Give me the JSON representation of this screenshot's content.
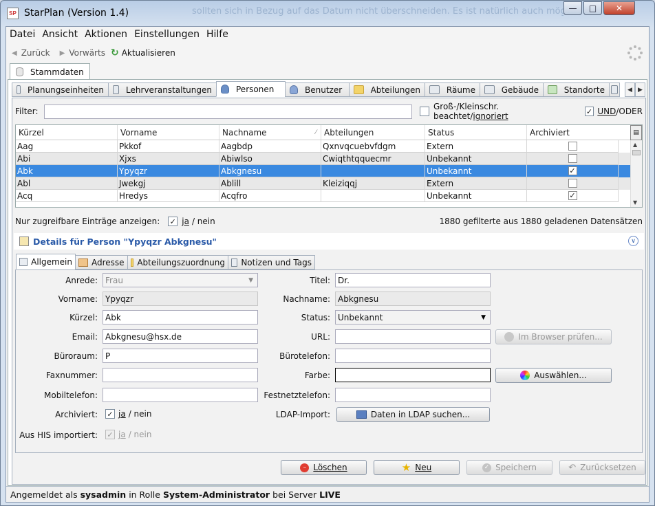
{
  "window": {
    "title": "StarPlan (Version 1.4)",
    "app_icon": "SP",
    "background_text": "sollten sich in Bezug auf das Datum nicht überschneiden. Es ist natürlich auch mög"
  },
  "menu": [
    {
      "label": "Datei"
    },
    {
      "label": "Ansicht"
    },
    {
      "label": "Aktionen"
    },
    {
      "label": "Einstellungen"
    },
    {
      "label": "Hilfe"
    }
  ],
  "nav": {
    "back": "Zurück",
    "forward": "Vorwärts",
    "refresh": "Aktualisieren"
  },
  "main_tab": "Stammdaten",
  "sub_tabs": [
    "Planungseinheiten",
    "Lehrveranstaltungen",
    "Personen",
    "Benutzer",
    "Abteilungen",
    "Räume",
    "Gebäude",
    "Standorte"
  ],
  "filter": {
    "label": "Filter:",
    "value": "",
    "case_label_pre": "Groß-/Kleinschr. beachtet/",
    "case_label_link": "ignoriert",
    "andor_label_link": "UND",
    "andor_label_post": "/ODER"
  },
  "table": {
    "columns": [
      "Kürzel",
      "Vorname",
      "Nachname",
      "Abteilungen",
      "Status",
      "Archiviert"
    ],
    "rows": [
      {
        "kuerzel": "Aag",
        "vorname": "Pkkof",
        "nachname": "Aagbdp",
        "abteilungen": "Qxnvqcuebvfdgm",
        "status": "Extern",
        "archiviert": false
      },
      {
        "kuerzel": "Abi",
        "vorname": "Xjxs",
        "nachname": "Abiwlso",
        "abteilungen": "Cwiqthtqquecmr",
        "status": "Unbekannt",
        "archiviert": false
      },
      {
        "kuerzel": "Abk",
        "vorname": "Ypyqzr",
        "nachname": "Abkgnesu",
        "abteilungen": "",
        "status": "Unbekannt",
        "archiviert": true
      },
      {
        "kuerzel": "Abl",
        "vorname": "Jwekgj",
        "nachname": "Ablill",
        "abteilungen": "Kleiziqqj",
        "status": "Extern",
        "archiviert": false
      },
      {
        "kuerzel": "Acq",
        "vorname": "Hredys",
        "nachname": "Acqfro",
        "abteilungen": "",
        "status": "Unbekannt",
        "archiviert": true
      }
    ]
  },
  "only_accessible": {
    "label": "Nur zugreifbare Einträge anzeigen:",
    "ja": "ja",
    "nein": "/ nein"
  },
  "count_text": "1880 gefilterte aus 1880 geladenen Datensätzen",
  "details_title": "Details für Person \"Ypyqzr Abkgnesu\"",
  "detail_tabs": [
    "Allgemein",
    "Adresse",
    "Abteilungszuordnung",
    "Notizen und Tags"
  ],
  "form": {
    "anrede": {
      "label": "Anrede:",
      "value": "Frau"
    },
    "vorname": {
      "label": "Vorname:",
      "value": "Ypyqzr"
    },
    "kuerzel": {
      "label": "Kürzel:",
      "value": "Abk"
    },
    "email": {
      "label": "Email:",
      "value": "Abkgnesu@hsx.de"
    },
    "bueroraum": {
      "label": "Büroraum:",
      "value": "P"
    },
    "faxnummer": {
      "label": "Faxnummer:",
      "value": ""
    },
    "mobiltelefon": {
      "label": "Mobiltelefon:",
      "value": ""
    },
    "archiviert": {
      "label": "Archiviert:",
      "ja": "ja",
      "nein": "/ nein"
    },
    "his": {
      "label": "Aus HIS importiert:",
      "ja": "ja",
      "nein": "/ nein"
    },
    "titel": {
      "label": "Titel:",
      "value": "Dr."
    },
    "nachname": {
      "label": "Nachname:",
      "value": "Abkgnesu"
    },
    "status": {
      "label": "Status:",
      "value": "Unbekannt"
    },
    "url": {
      "label": "URL:",
      "value": ""
    },
    "buerotelefon": {
      "label": "Bürotelefon:",
      "value": ""
    },
    "farbe": {
      "label": "Farbe:",
      "value": ""
    },
    "festnetz": {
      "label": "Festnetztelefon:",
      "value": ""
    },
    "ldap": {
      "label": "LDAP-Import:"
    },
    "browser_btn": "Im Browser prüfen...",
    "choose_btn": "Auswählen...",
    "ldap_btn": "Daten in LDAP suchen..."
  },
  "actions": {
    "delete": "Löschen",
    "new": "Neu",
    "save": "Speichern",
    "reset": "Zurücksetzen"
  },
  "status": {
    "pre": "Angemeldet als ",
    "user": "sysadmin",
    "mid": " in Rolle ",
    "role": "System-Administrator",
    "mid2": " bei Server ",
    "server": "LIVE"
  },
  "colors": {
    "selection": "#3a89e0",
    "heading": "#2a5aa8"
  }
}
